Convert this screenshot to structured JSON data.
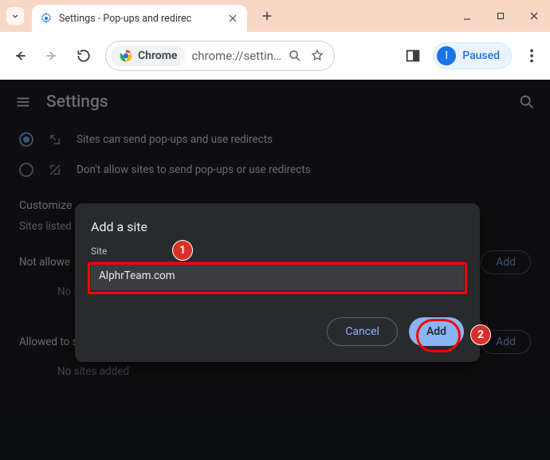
{
  "titlebar": {
    "tab_title": "Settings - Pop-ups and redirec"
  },
  "toolbar": {
    "chrome_chip": "Chrome",
    "url": "chrome://settin…",
    "profile_state": "Paused",
    "profile_initial": "I"
  },
  "page": {
    "title": "Settings",
    "radio_allow": "Sites can send pop-ups and use redirects",
    "radio_block": "Don't allow sites to send pop-ups or use redirects",
    "customize_heading": "Customize",
    "customize_sub": "Sites listed",
    "not_allowed_title": "Not allowe",
    "not_allowed_empty": "No s",
    "allowed_title": "Allowed to send pop-ups and use redirects",
    "allowed_empty": "No sites added",
    "add_btn": "Add"
  },
  "dialog": {
    "title": "Add a site",
    "label": "Site",
    "input_value": "AlphrTeam.com",
    "cancel": "Cancel",
    "add": "Add"
  },
  "badges": {
    "one": "1",
    "two": "2"
  }
}
